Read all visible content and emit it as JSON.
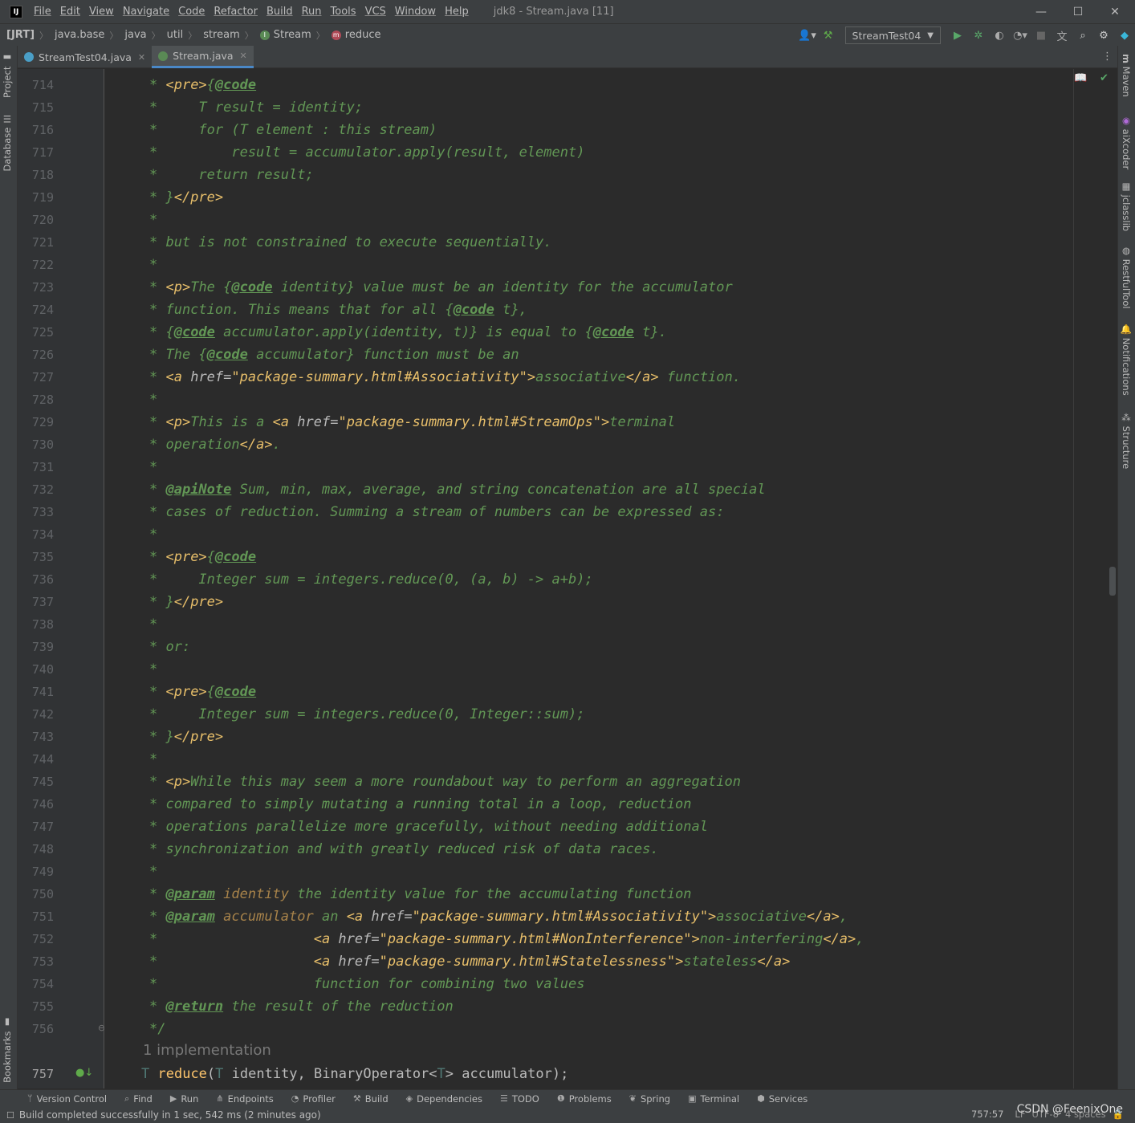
{
  "app": {
    "logo_text": "IJ",
    "title": "jdk8 - Stream.java [11]"
  },
  "menu": [
    "File",
    "Edit",
    "View",
    "Navigate",
    "Code",
    "Refactor",
    "Build",
    "Run",
    "Tools",
    "VCS",
    "Window",
    "Help"
  ],
  "window_controls": {
    "minimize": "—",
    "maximize": "☐",
    "close": "✕"
  },
  "breadcrumbs": [
    "[JRT]",
    "java.base",
    "java",
    "util",
    "stream",
    "Stream",
    "reduce"
  ],
  "toolbar": {
    "run_config": "StreamTest04"
  },
  "tabs": [
    {
      "label": "StreamTest04.java",
      "active": false
    },
    {
      "label": "Stream.java",
      "active": true
    }
  ],
  "left_tool_windows": [
    "Project",
    "Database",
    "Bookmarks"
  ],
  "right_tool_windows": [
    "Maven",
    "aiXcoder",
    "jclasslib",
    "RestfulTool",
    "Notifications",
    "Structure"
  ],
  "line_numbers": [
    "714",
    "715",
    "716",
    "717",
    "718",
    "719",
    "720",
    "721",
    "722",
    "723",
    "724",
    "725",
    "726",
    "727",
    "728",
    "729",
    "730",
    "731",
    "732",
    "733",
    "734",
    "735",
    "736",
    "737",
    "738",
    "739",
    "740",
    "741",
    "742",
    "743",
    "744",
    "745",
    "746",
    "747",
    "748",
    "749",
    "750",
    "751",
    "752",
    "753",
    "754",
    "755",
    "756",
    "757"
  ],
  "inlay_hint": "1 implementation",
  "code": {
    "t": "T",
    "method": "reduce",
    "open": "(",
    "arg1_type": "T",
    "arg1": " identity, BinaryOperator<",
    "arg2_type": "T",
    "arg2": "> accumulator);"
  },
  "bottom_tools": [
    "Version Control",
    "Find",
    "Run",
    "Endpoints",
    "Profiler",
    "Build",
    "Dependencies",
    "TODO",
    "Problems",
    "Spring",
    "Terminal",
    "Services"
  ],
  "status": {
    "message": "Build completed successfully in 1 sec, 542 ms (2 minutes ago)",
    "position": "757:57",
    "line_sep": "LF",
    "encoding": "UTF-8",
    "indent": "4 spaces"
  },
  "watermark": "CSDN @FeenixOne"
}
